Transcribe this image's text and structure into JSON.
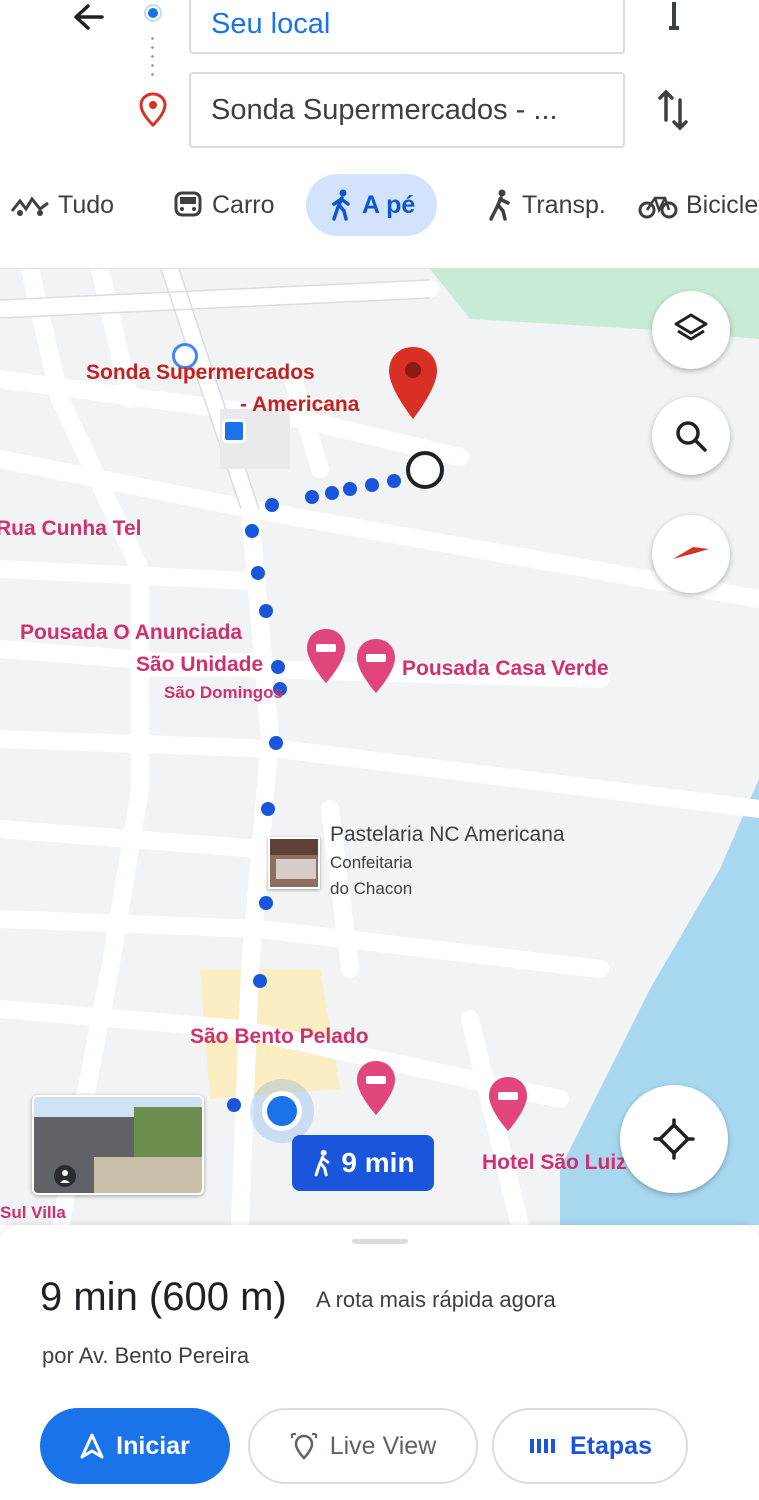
{
  "header": {
    "origin_value": "Seu local",
    "destination_value": "Sonda Supermercados - ..."
  },
  "modes": [
    {
      "label": "Tudo"
    },
    {
      "label": "Carro"
    },
    {
      "label": "A pé"
    },
    {
      "label": "Transp."
    },
    {
      "label": "Bicicleta"
    }
  ],
  "map": {
    "destination_label_line1": "Sonda Supermercados",
    "destination_label_line2": "- Americana",
    "street_left": "Rua Cunha Tel",
    "poi_pousada_line1": "Pousada O Anunciada",
    "poi_pousada_line2": "São Unidade",
    "poi_pousada_line3": "São Domingos",
    "poi_pousada_right": "Pousada Casa Verde",
    "poi_place_line1": "Pastelaria NC Americana",
    "poi_place_line2": "Confeitaria",
    "poi_place_line3": "do Chacon",
    "poi_bottom_left": "São Bento Pelado",
    "poi_bottom_right": "Hotel São Luiz",
    "poi_far_left": "Sul Villa",
    "eta_badge": "9 min"
  },
  "summary": {
    "main": "9 min (600 m)",
    "note": "A rota mais rápida agora",
    "via": "por Av. Bento Pereira"
  },
  "actions": {
    "start": "Iniciar",
    "live_view": "Live View",
    "steps": "Etapas"
  },
  "colors": {
    "accent": "#1a73e8",
    "route_dot": "#1a56db",
    "destination_pin": "#d93025",
    "lodging_pin": "#e0457b",
    "water": "#a8d8f0",
    "park": "#c8ebd7"
  }
}
